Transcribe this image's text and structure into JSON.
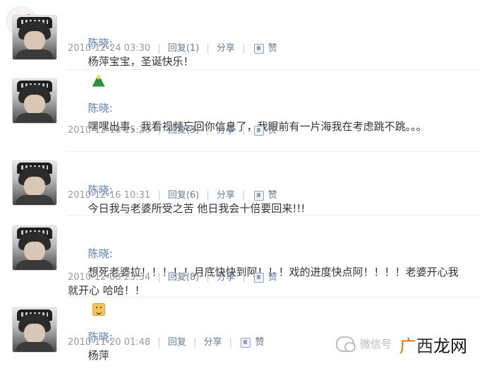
{
  "posts": [
    {
      "author": "陈晓:",
      "message": "杨萍宝宝，圣诞快乐！",
      "emoji": "christmas-tree",
      "timestamp": "2010-12-24 03:30",
      "reply_label": "回复(1)",
      "share_label": "分享",
      "like_label": "赞"
    },
    {
      "author": "陈晓:",
      "message": "嘿嘿出事，我看视频忘回你信息了，我眼前有一片海我在考虑跳不跳。。。",
      "emoji": "",
      "timestamp": "2010-12-18 15:20",
      "reply_label": "回复(3)",
      "share_label": "分享",
      "like_label": "赞"
    },
    {
      "author": "陈晓:",
      "message": "今日我与老婆所受之苦 他日我会十倍要回来!!!",
      "emoji": "",
      "timestamp": "2010-12-16 10:31",
      "reply_label": "回复(6)",
      "share_label": "分享",
      "like_label": "赞"
    },
    {
      "author": "陈晓:",
      "message": "想死老婆拉！！！！！月底快快到阿！！！戏的进度快点阿！！！！老婆开心我就开心 哈哈！！",
      "emoji": "smile",
      "timestamp": "2010-12-08 23:34",
      "reply_label": "回复(8)",
      "share_label": "分享",
      "like_label": "赞"
    },
    {
      "author": "陈晓:",
      "message": "杨萍",
      "emoji": "",
      "timestamp": "2010-11-20 01:48",
      "reply_label": "回复",
      "share_label": "分享",
      "like_label": "赞"
    }
  ],
  "watermark": {
    "text": "微信号",
    "brand_1": "广",
    "brand_2": "西",
    "brand_3": "龙网"
  },
  "icons": {
    "top_left": "add-post-icon",
    "wechat": "wechat-icon",
    "thumb": "thumb-up-icon"
  }
}
